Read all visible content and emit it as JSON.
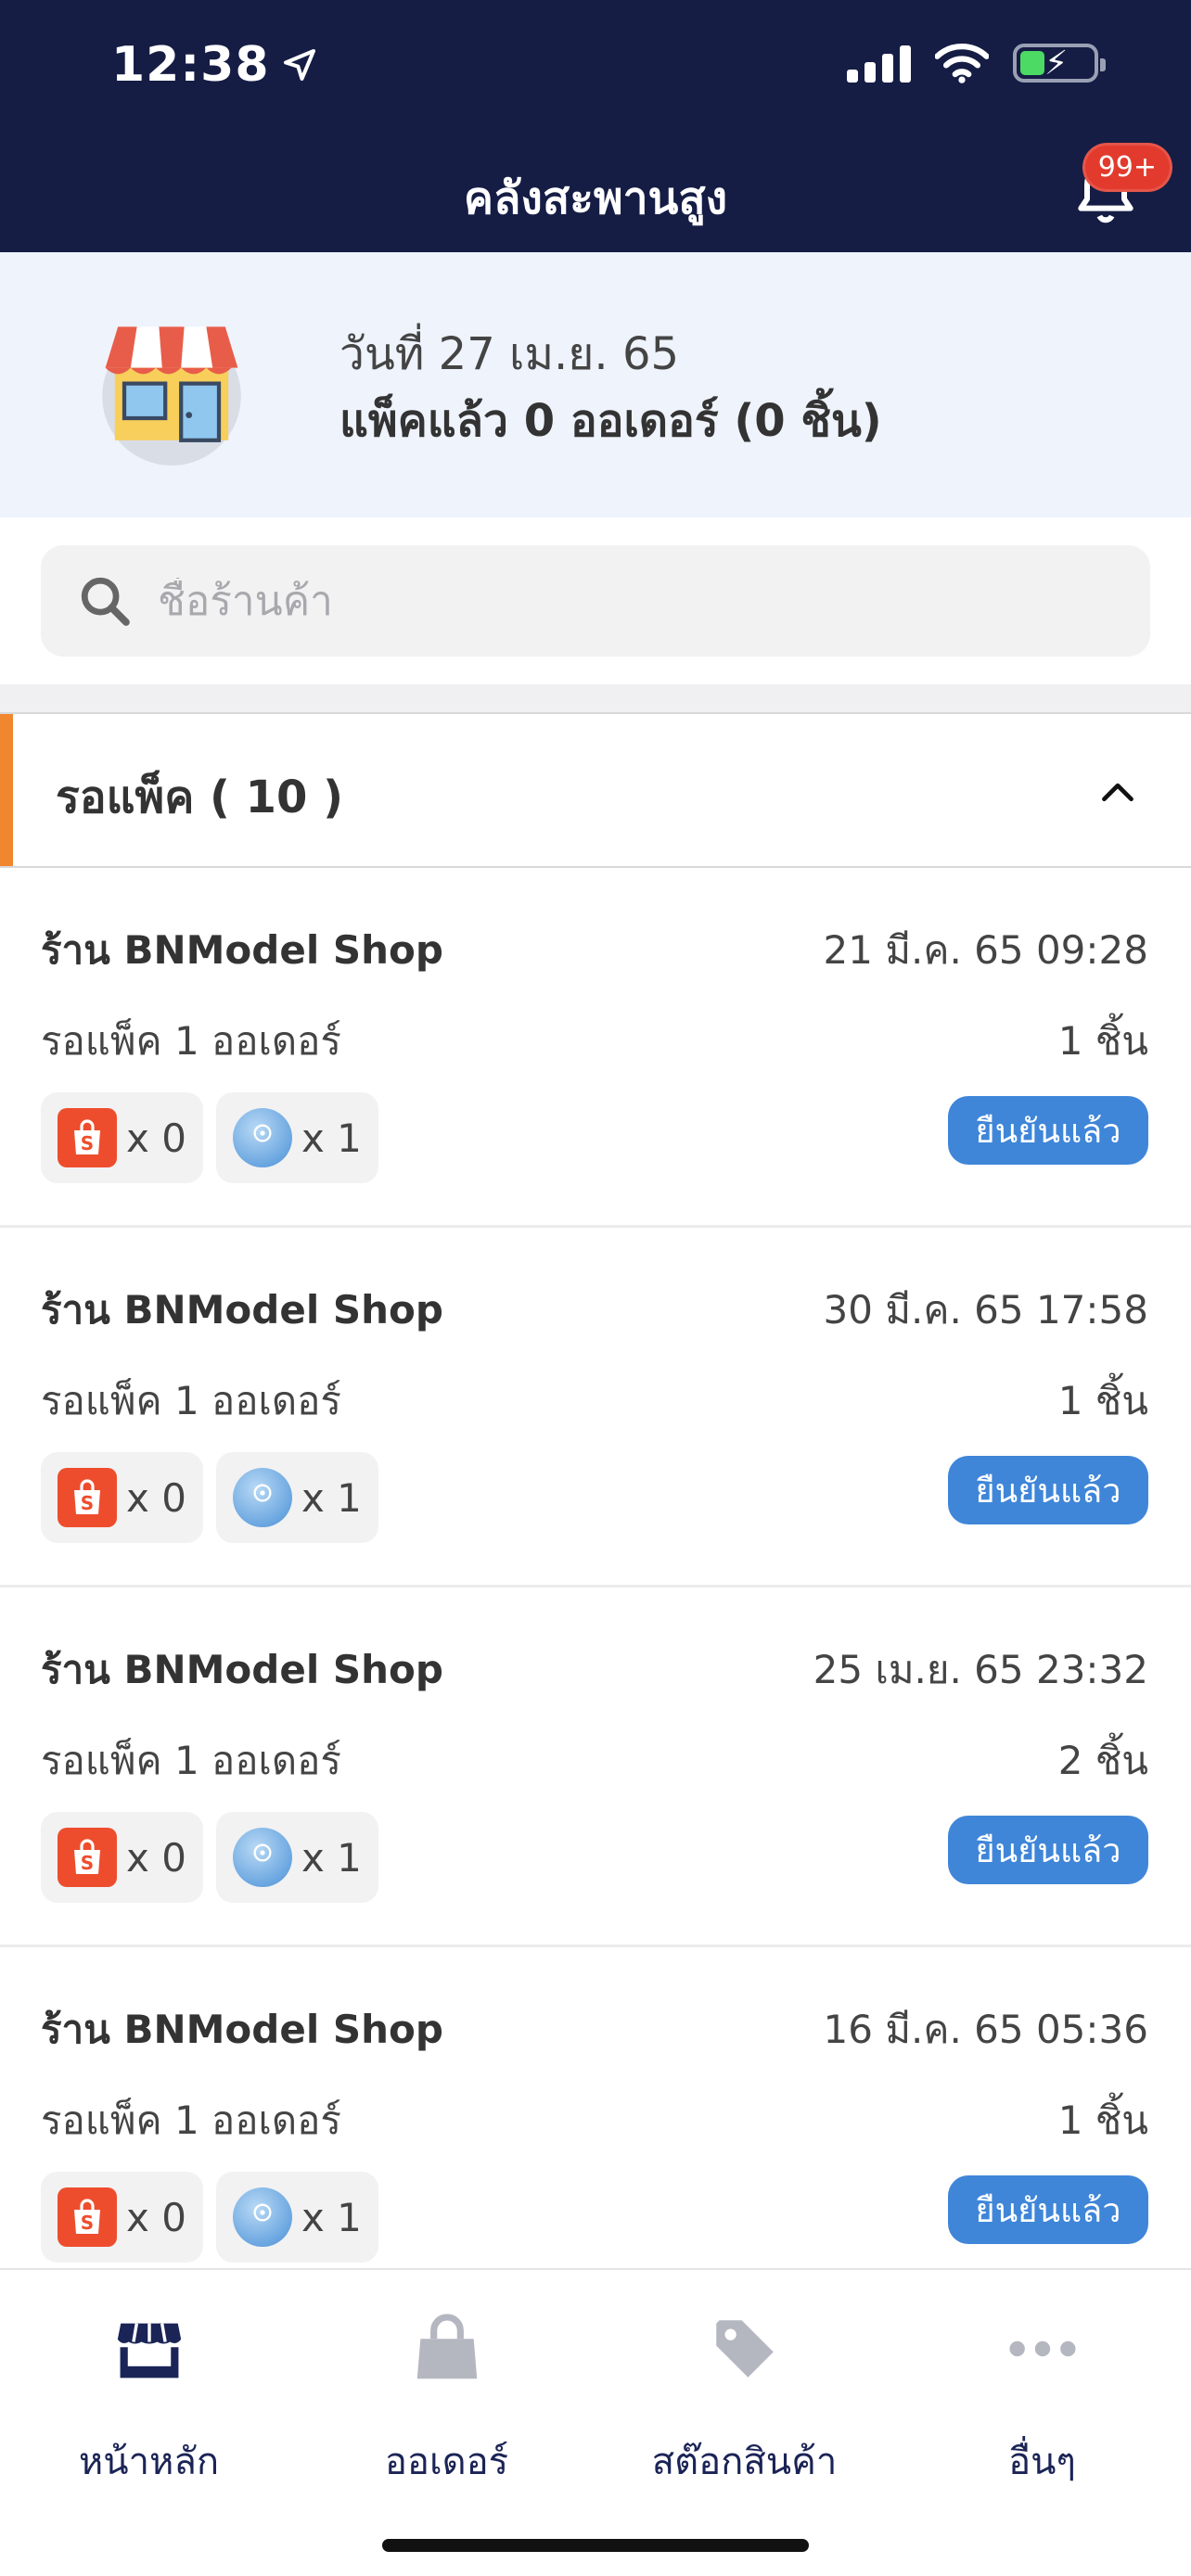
{
  "status_bar": {
    "time": "12:38"
  },
  "header": {
    "title": "คลังสะพานสูง",
    "notification_badge": "99+"
  },
  "summary": {
    "date": "วันที่ 27 เม.ย. 65",
    "packed": "แพ็คแล้ว 0 ออเดอร์ (0 ชิ้น)"
  },
  "search": {
    "placeholder": "ชื่อร้านค้า"
  },
  "section": {
    "title": "รอแพ็ค ( 10 )"
  },
  "orders": [
    {
      "shop": "ร้าน BNModel Shop",
      "datetime": "21 มี.ค. 65 09:28",
      "pending": "รอแพ็ค 1 ออเดอร์",
      "pieces": "1 ชิ้น",
      "shopee_count": "x 0",
      "lifeaf_count": "x 1",
      "button": "ยืนยันแล้ว"
    },
    {
      "shop": "ร้าน BNModel Shop",
      "datetime": "30 มี.ค. 65 17:58",
      "pending": "รอแพ็ค 1 ออเดอร์",
      "pieces": "1 ชิ้น",
      "shopee_count": "x 0",
      "lifeaf_count": "x 1",
      "button": "ยืนยันแล้ว"
    },
    {
      "shop": "ร้าน BNModel Shop",
      "datetime": "25 เม.ย. 65 23:32",
      "pending": "รอแพ็ค 1 ออเดอร์",
      "pieces": "2 ชิ้น",
      "shopee_count": "x 0",
      "lifeaf_count": "x 1",
      "button": "ยืนยันแล้ว"
    },
    {
      "shop": "ร้าน BNModel Shop",
      "datetime": "16 มี.ค. 65 05:36",
      "pending": "รอแพ็ค 1 ออเดอร์",
      "pieces": "1 ชิ้น",
      "shopee_count": "x 0",
      "lifeaf_count": "x 1",
      "button": "ยืนยันแล้ว"
    }
  ],
  "bottom_nav": [
    {
      "label": "หน้าหลัก",
      "icon": "store-icon",
      "active": true
    },
    {
      "label": "ออเดอร์",
      "icon": "shopping-bag-icon",
      "active": false
    },
    {
      "label": "สต๊อกสินค้า",
      "icon": "tag-icon",
      "active": false
    },
    {
      "label": "อื่นๆ",
      "icon": "more-dots-icon",
      "active": false
    }
  ],
  "colors": {
    "header_bg": "#151d45",
    "accent_orange": "#f0872e",
    "button_blue": "#3f86d8",
    "summary_bg": "#eef3fc",
    "badge_red": "#e23b2e"
  }
}
